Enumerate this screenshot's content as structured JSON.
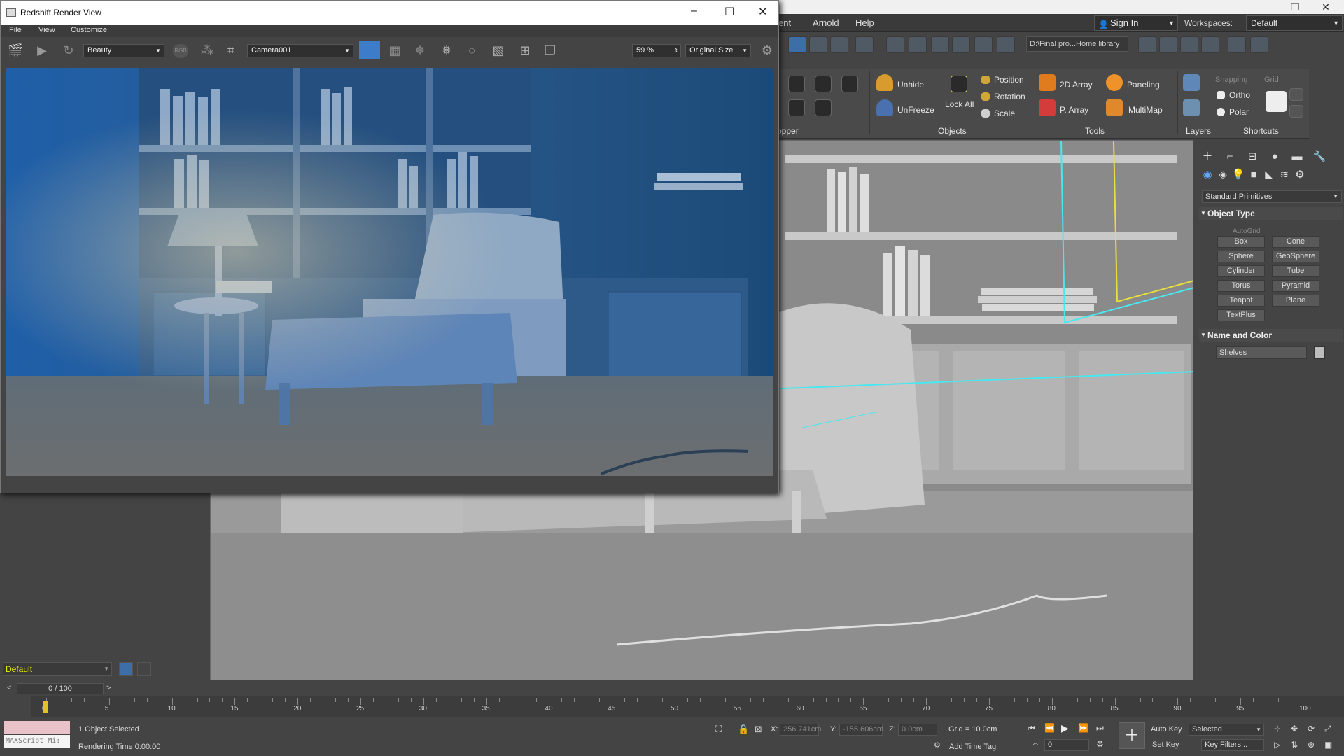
{
  "main_window": {
    "menus": [
      "ent",
      "Arnold",
      "Help"
    ],
    "sign_in": "Sign In",
    "workspaces_label": "Workspaces:",
    "workspace": "Default",
    "path": "D:\\Final pro...Home library",
    "window_controls": {
      "minimize": "–",
      "restore": "❐",
      "close": "✕"
    }
  },
  "ribbon": {
    "items": {
      "unhide": "Unhide",
      "unfreeze": "UnFreeze",
      "lock_all": "Lock All",
      "position": "Position",
      "rotation": "Rotation",
      "scale": "Scale",
      "array_2d": "2D Array",
      "p_array": "P. Array",
      "paneling": "Paneling",
      "multimap": "MultiMap",
      "snapping": "Snapping",
      "grid": "Grid",
      "ortho": "Ortho",
      "polar": "Polar"
    },
    "groups": {
      "dropper": "opper",
      "objects": "Objects",
      "tools": "Tools",
      "layers": "Layers",
      "shortcuts": "Shortcuts"
    }
  },
  "command_panel": {
    "category": "Standard Primitives",
    "object_type_title": "Object Type",
    "autogrid": "AutoGrid",
    "primitives": [
      "Box",
      "Cone",
      "Sphere",
      "GeoSphere",
      "Cylinder",
      "Tube",
      "Torus",
      "Pyramid",
      "Teapot",
      "Plane",
      "TextPlus"
    ],
    "name_color_title": "Name and Color",
    "object_name": "Shelves",
    "object_color": "#bdbdbd"
  },
  "left_panel": {
    "layer": "Default",
    "time_slider": "0 / 100"
  },
  "timeline": {
    "ticks": [
      "0",
      "5",
      "10",
      "15",
      "20",
      "25",
      "30",
      "35",
      "40",
      "45",
      "50",
      "55",
      "60",
      "65",
      "70",
      "75",
      "80",
      "85",
      "90",
      "95",
      "100"
    ]
  },
  "status": {
    "maxscript": "MAXScript Mi:",
    "selection": "1 Object Selected",
    "rendering_time": "Rendering Time  0:00:00",
    "x_label": "X:",
    "x_value": "256.741cm",
    "y_label": "Y:",
    "y_value": "-155.606cm",
    "z_label": "Z:",
    "z_value": "0.0cm",
    "grid": "Grid = 10.0cm",
    "add_time_tag": "Add Time Tag",
    "auto_key": "Auto Key",
    "set_key": "Set Key",
    "key_mode": "Selected",
    "key_filters": "Key Filters...",
    "frame": "0"
  },
  "render_window": {
    "title": "Redshift Render View",
    "menus": [
      "File",
      "View",
      "Customize"
    ],
    "aov": "Beauty",
    "rgb": "RGB",
    "camera": "Camera001",
    "zoom": "59 %",
    "size": "Original Size",
    "window_controls": {
      "minimize": "–",
      "maximize": "☐",
      "close": "✕"
    }
  },
  "colors": {
    "accent_blue": "#3d7cc9",
    "selection_cyan": "#47e8f0",
    "selection_yellow": "#e8e03a"
  }
}
